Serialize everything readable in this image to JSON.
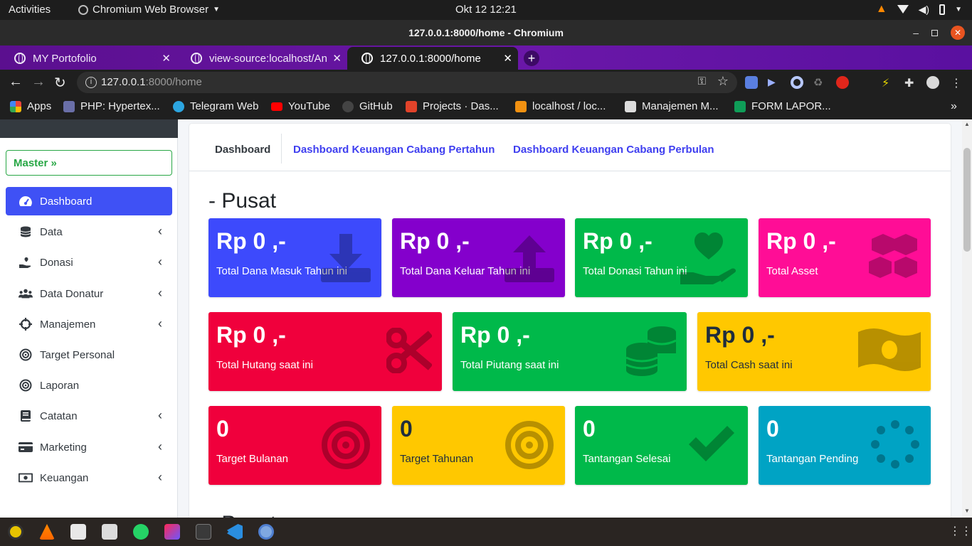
{
  "system_bar": {
    "activities": "Activities",
    "app_name": "Chromium Web Browser",
    "clock": "Okt 12  12:21"
  },
  "window": {
    "title": "127.0.0.1:8000/home - Chromium"
  },
  "tabs": [
    {
      "label": "MY Portofolio",
      "active": false
    },
    {
      "label": "view-source:localhost/An",
      "active": false
    },
    {
      "label": "127.0.0.1:8000/home",
      "active": true
    }
  ],
  "address_bar": {
    "url_host": "127.0.0.1",
    "url_rest": ":8000/home"
  },
  "bookmarks": [
    {
      "label": "Apps",
      "icon": "apps-grid-icon",
      "color": "#e8453c"
    },
    {
      "label": "PHP: Hypertex...",
      "icon": "php-icon",
      "color": "#6a6fa8"
    },
    {
      "label": "Telegram Web",
      "icon": "telegram-icon",
      "color": "#2ca5e0"
    },
    {
      "label": "YouTube",
      "icon": "youtube-icon",
      "color": "#ff0000"
    },
    {
      "label": "GitHub",
      "icon": "github-icon",
      "color": "#444444"
    },
    {
      "label": "Projects · Das...",
      "icon": "gitlab-icon",
      "color": "#e2432a"
    },
    {
      "label": "localhost / loc...",
      "icon": "phpmyadmin-icon",
      "color": "#f29111"
    },
    {
      "label": "Manajemen M...",
      "icon": "bookmark-page-icon",
      "color": "#dddddd"
    },
    {
      "label": "FORM LAPOR...",
      "icon": "forms-icon",
      "color": "#0f9d58"
    }
  ],
  "sidebar": {
    "master_label": "Master",
    "items": [
      {
        "label": "Dashboard",
        "icon": "tachometer-icon",
        "active": true,
        "has_chevron": false
      },
      {
        "label": "Data",
        "icon": "database-icon",
        "active": false,
        "has_chevron": true
      },
      {
        "label": "Donasi",
        "icon": "hand-holding-heart-icon",
        "active": false,
        "has_chevron": true
      },
      {
        "label": "Data Donatur",
        "icon": "users-icon",
        "active": false,
        "has_chevron": true
      },
      {
        "label": "Manajemen",
        "icon": "crosshairs-icon",
        "active": false,
        "has_chevron": true
      },
      {
        "label": "Target Personal",
        "icon": "bullseye-icon",
        "active": false,
        "has_chevron": false
      },
      {
        "label": "Laporan",
        "icon": "bullseye-icon",
        "active": false,
        "has_chevron": false
      },
      {
        "label": "Catatan",
        "icon": "book-icon",
        "active": false,
        "has_chevron": true
      },
      {
        "label": "Marketing",
        "icon": "credit-card-icon",
        "active": false,
        "has_chevron": true
      },
      {
        "label": "Keuangan",
        "icon": "money-bill-icon",
        "active": false,
        "has_chevron": true
      }
    ]
  },
  "content_tabs": {
    "dashboard": "Dashboard",
    "yearly": "Dashboard Keuangan Cabang Pertahun",
    "monthly": "Dashboard Keuangan Cabang Perbulan"
  },
  "section": {
    "title": "- Pusat",
    "next_title": "- Pusat"
  },
  "stat_boxes": [
    {
      "value": "Rp 0 ,-",
      "label": "Total Dana Masuk Tahun ini",
      "icon": "download-icon",
      "color": "#3d4afc"
    },
    {
      "value": "Rp 0 ,-",
      "label": "Total Dana Keluar Tahun ini",
      "icon": "upload-icon",
      "color": "#8400cc"
    },
    {
      "value": "Rp 0 ,-",
      "label": "Total Donasi Tahun ini",
      "icon": "hand-holding-heart-icon",
      "color": "#00b94a"
    },
    {
      "value": "Rp 0 ,-",
      "label": "Total Asset",
      "icon": "cubes-icon",
      "color": "#ff0d96"
    },
    {
      "value": "Rp 0 ,-",
      "label": "Total Hutang saat ini",
      "icon": "scissors-icon",
      "color": "#f0003c"
    },
    {
      "value": "Rp 0 ,-",
      "label": "Total Piutang saat ini",
      "icon": "coins-icon",
      "color": "#00b94a"
    },
    {
      "value": "Rp 0 ,-",
      "label": "Total Cash saat ini",
      "icon": "money-bill-wave-icon",
      "color": "#ffc800"
    },
    {
      "value": "0",
      "label": "Target Bulanan",
      "icon": "bullseye-icon",
      "color": "#f0003c"
    },
    {
      "value": "0",
      "label": "Target Tahunan",
      "icon": "bullseye-icon",
      "color": "#ffc800"
    },
    {
      "value": "0",
      "label": "Tantangan Selesai",
      "icon": "check-icon",
      "color": "#00b94a"
    },
    {
      "value": "0",
      "label": "Tantangan Pending",
      "icon": "spinner-icon",
      "color": "#00a3c4"
    }
  ]
}
